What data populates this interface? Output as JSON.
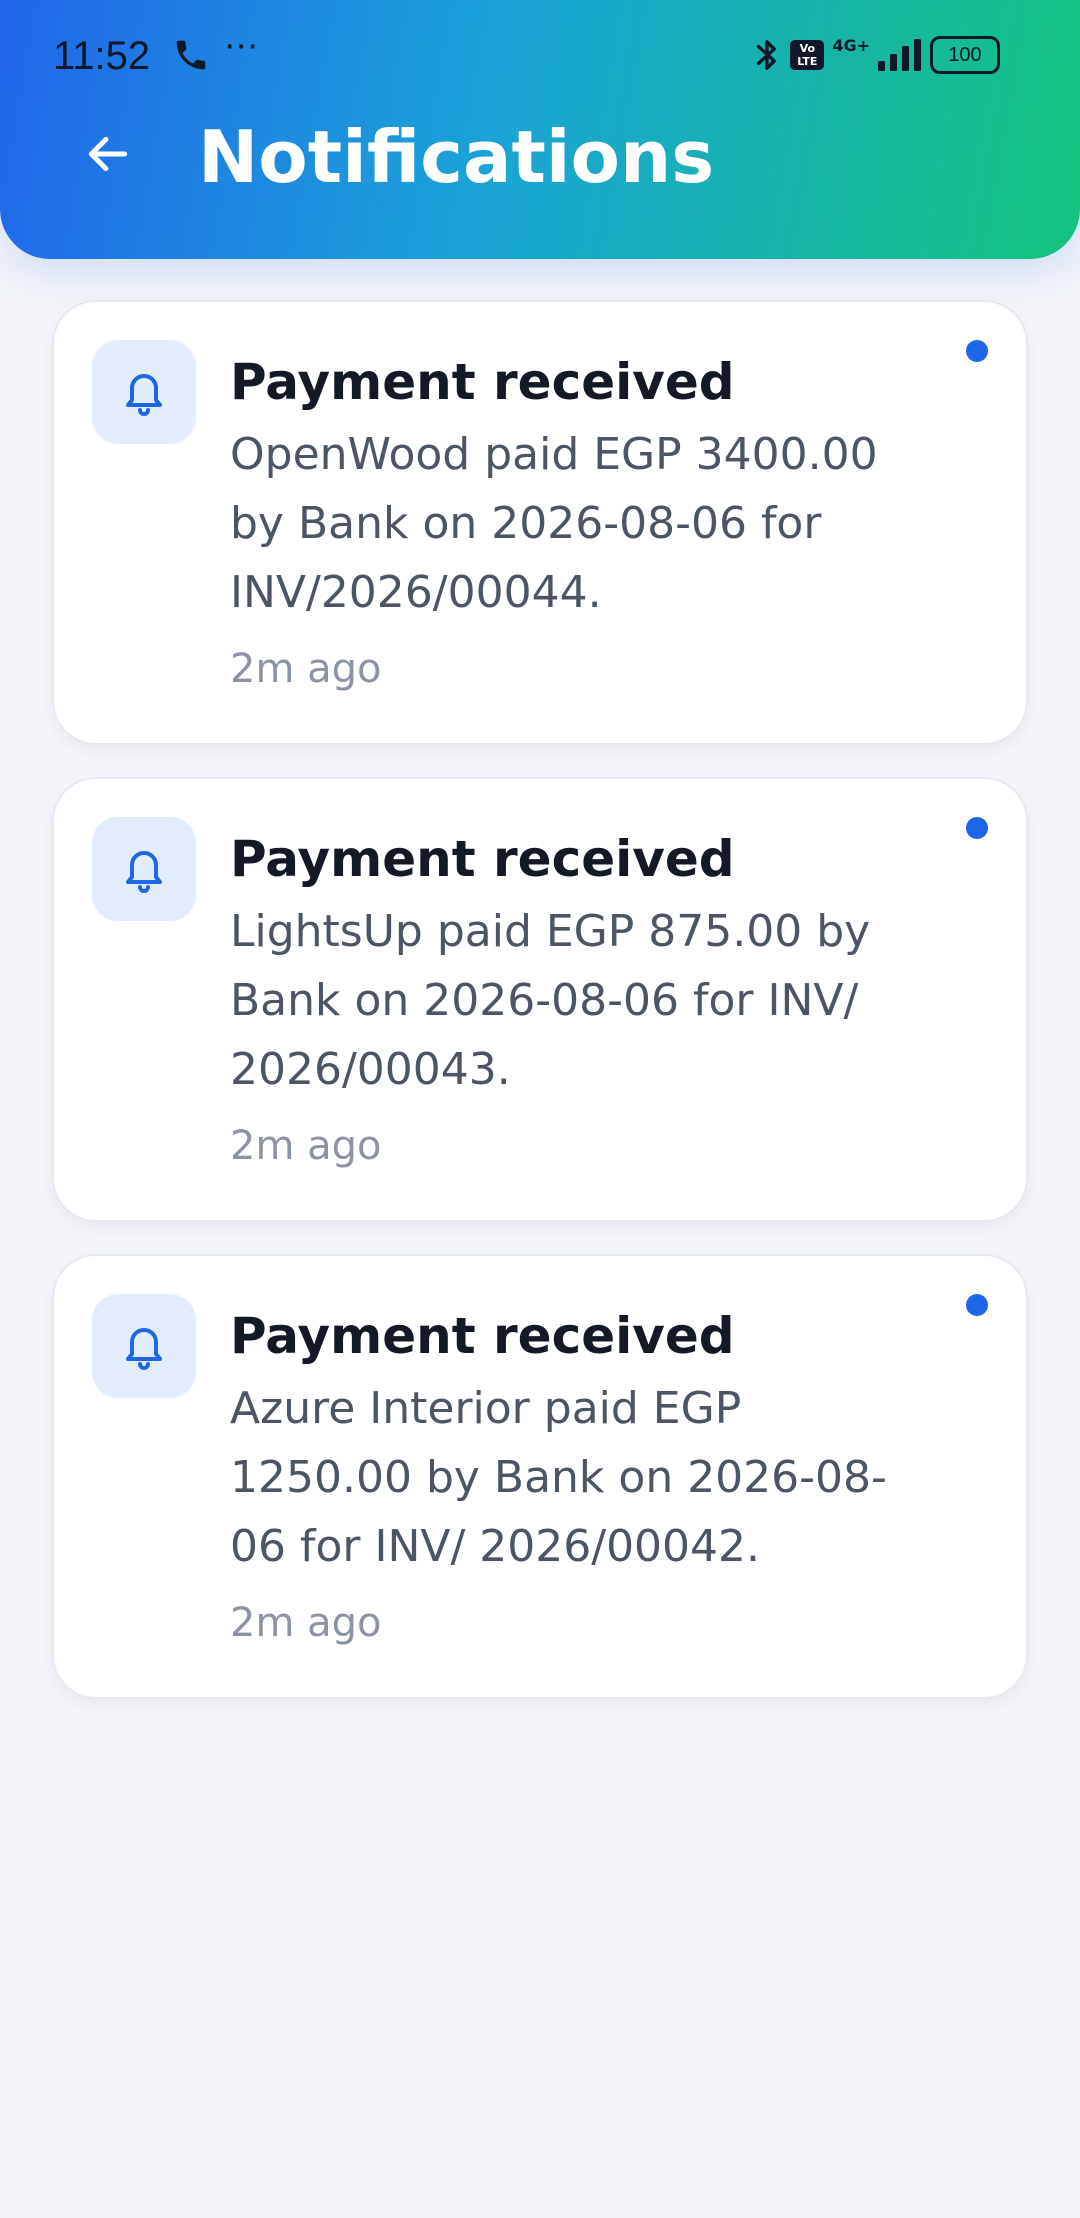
{
  "status_bar": {
    "time": "11:52",
    "more": "⋯",
    "volte_top": "Vo",
    "volte_bottom": "LTE",
    "network": "4G+",
    "battery": "100",
    "text_color": "#111827"
  },
  "header": {
    "title": "Notifications",
    "gradient_colors": [
      "#2166ea",
      "#1aa3d8",
      "#13c47d"
    ]
  },
  "notifications": [
    {
      "icon": "bell-icon",
      "title": "Payment received",
      "text": "OpenWood paid EGP 3400.00 by Bank on 2026-08-06 for INV/2026/00044.",
      "time": "2m ago",
      "unread": true
    },
    {
      "icon": "bell-icon",
      "title": "Payment received",
      "text": "LightsUp paid EGP 875.00 by Bank on 2026-08-06 for INV/ 2026/00043.",
      "time": "2m ago",
      "unread": true
    },
    {
      "icon": "bell-icon",
      "title": "Payment received",
      "text": "Azure Interior paid EGP 1250.00 by Bank on 2026-08-06 for INV/ 2026/00042.",
      "time": "2m ago",
      "unread": true
    }
  ],
  "colors": {
    "accent": "#1d66e5",
    "icon_bg": "#e3ecfd",
    "background": "#f3f5f9",
    "card": "#ffffff"
  }
}
